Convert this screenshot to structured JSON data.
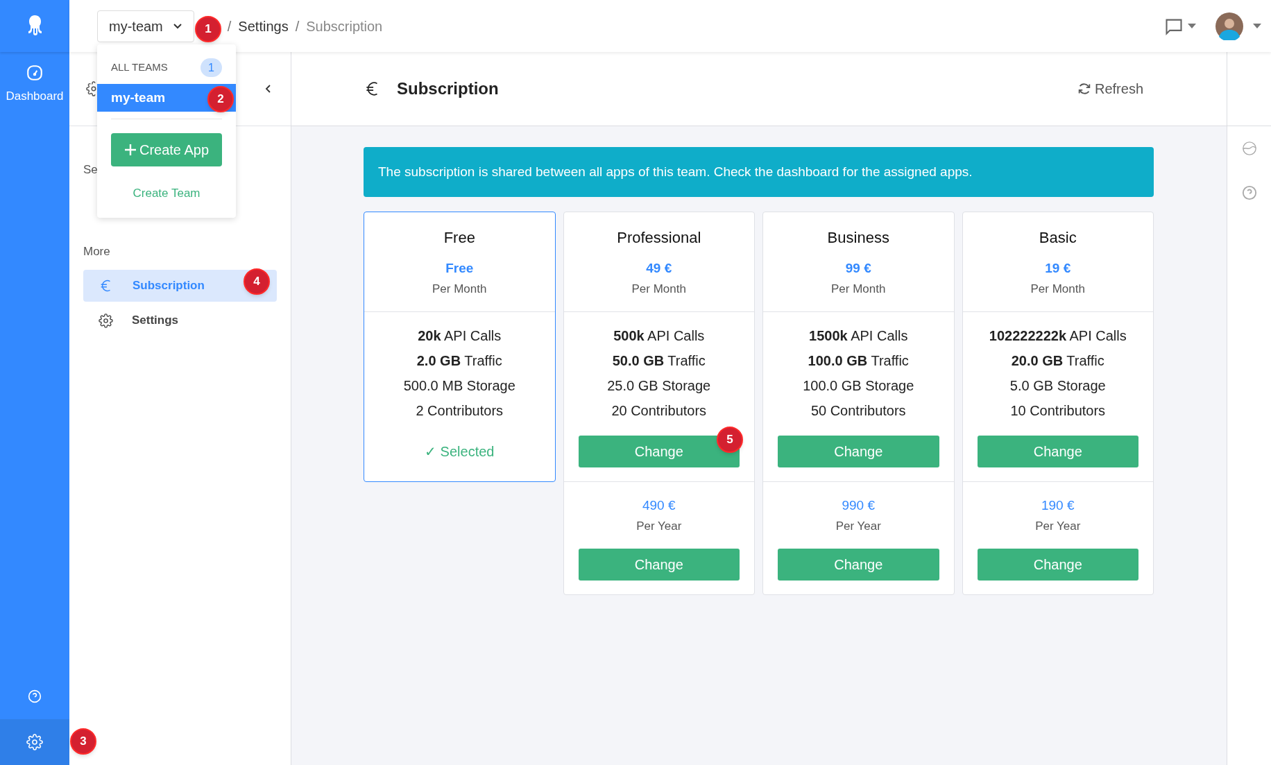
{
  "rail": {
    "items": [
      {
        "label": "Dashboard",
        "selected": false
      }
    ],
    "bottom": [
      {
        "kind": "help",
        "selected": false
      },
      {
        "kind": "settings",
        "selected": true
      }
    ]
  },
  "topbar": {
    "team": "my-team",
    "breadcrumb": [
      {
        "text": "/",
        "kind": "separator"
      },
      {
        "text": "Settings",
        "kind": "link"
      },
      {
        "text": "/",
        "kind": "separator"
      },
      {
        "text": "Subscription",
        "kind": "current"
      }
    ]
  },
  "team_menu": {
    "heading": "ALL TEAMS",
    "count": "1",
    "teams": [
      {
        "label": "my-team",
        "selected": true
      }
    ],
    "create_app": "Create App",
    "create_team": "Create Team"
  },
  "sidebar": {
    "section_heading": "Se",
    "more_heading": "More",
    "items": [
      {
        "label": "Subscription",
        "kind": "euro",
        "selected": true
      },
      {
        "label": "Settings",
        "kind": "gear",
        "selected": false
      }
    ]
  },
  "page": {
    "title": "Subscription",
    "refresh": "Refresh",
    "alert": "The subscription is shared between all apps of this team. Check the dashboard for the assigned apps."
  },
  "plans": [
    {
      "name": "Free",
      "selected": true,
      "price": "Free",
      "period": "Per Month",
      "features": [
        "**20k** API Calls",
        "**2.0 GB** Traffic",
        "500.0 MB Storage",
        "2 Contributors"
      ],
      "status": "✓ Selected"
    },
    {
      "name": "Professional",
      "selected": false,
      "price": "49 €",
      "period": "Per Month",
      "features": [
        "**500k** API Calls",
        "**50.0 GB** Traffic",
        "25.0 GB Storage",
        "20 Contributors"
      ],
      "action": "Change",
      "yearly": {
        "price": "490 €",
        "period": "Per Year",
        "action": "Change"
      }
    },
    {
      "name": "Business",
      "selected": false,
      "price": "99 €",
      "period": "Per Month",
      "features": [
        "**1500k** API Calls",
        "**100.0 GB** Traffic",
        "100.0 GB Storage",
        "50 Contributors"
      ],
      "action": "Change",
      "yearly": {
        "price": "990 €",
        "period": "Per Year",
        "action": "Change"
      }
    },
    {
      "name": "Basic",
      "selected": false,
      "price": "19 €",
      "period": "Per Month",
      "features": [
        "**102222222k** API Calls",
        "**20.0 GB** Traffic",
        "5.0 GB Storage",
        "10 Contributors"
      ],
      "action": "Change",
      "yearly": {
        "price": "190 €",
        "period": "Per Year",
        "action": "Change"
      }
    }
  ],
  "annotations": [
    "1",
    "2",
    "3",
    "4",
    "5"
  ]
}
